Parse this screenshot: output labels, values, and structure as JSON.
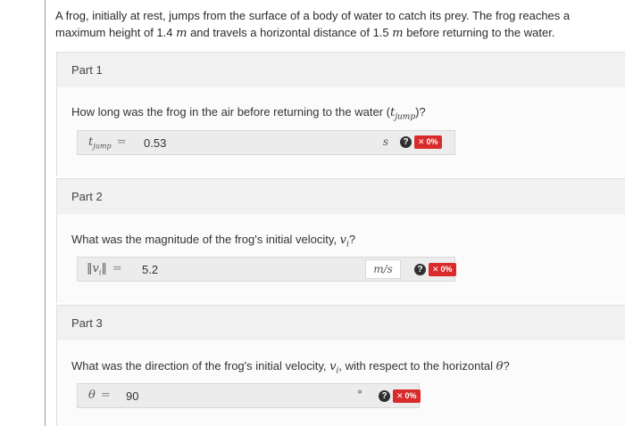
{
  "problem": {
    "text_line1_before": "A frog, initially at rest, jumps from the surface of a body of water to catch its prey. The frog reaches a",
    "text_line2_a": "maximum height of 1.4 ",
    "unit_m_1": "m",
    "text_line2_b": " and travels a horizontal distance of 1.5 ",
    "unit_m_2": "m",
    "text_line2_c": " before returning to the water."
  },
  "parts": [
    {
      "header": "Part 1",
      "question_before": "How long was the frog in the air before returning to the water (",
      "question_var": "t",
      "question_sub": "jump",
      "question_after": ")?",
      "answer_label": "t",
      "answer_label_sub": "jump",
      "equals": "=",
      "answer_value": "0.53",
      "units": "s",
      "help": "?",
      "score": "0%",
      "score_x": "✕"
    },
    {
      "header": "Part 2",
      "question_before": "What was the magnitude of the frog's initial velocity, ",
      "question_var": "v",
      "question_sub": "i",
      "question_after": "?",
      "answer_label": "‖v",
      "answer_label_sub": "i",
      "answer_label_after": "‖",
      "equals": "=",
      "answer_value": "5.2",
      "units": "m/s",
      "help": "?",
      "score": "0%",
      "score_x": "✕"
    },
    {
      "header": "Part 3",
      "question_before": "What was the direction of the frog's initial velocity, ",
      "question_var": "v",
      "question_sub": "i",
      "question_after": ", with respect to the horizontal ",
      "question_theta": "θ",
      "question_end": "?",
      "answer_label": "θ",
      "equals": "=",
      "answer_value": "90",
      "units": "°",
      "help": "?",
      "score": "0%",
      "score_x": "✕"
    }
  ]
}
